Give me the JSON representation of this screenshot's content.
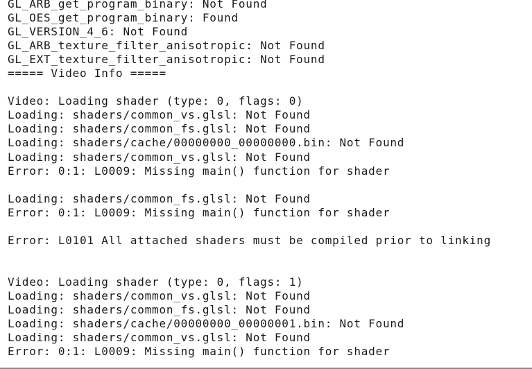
{
  "console": {
    "lines": [
      "GL_ARB_get_program_binary: Not Found",
      "GL_OES_get_program_binary: Found",
      "GL_VERSION_4_6: Not Found",
      "GL_ARB_texture_filter_anisotropic: Not Found",
      "GL_EXT_texture_filter_anisotropic: Not Found",
      "===== Video Info =====",
      "",
      "Video: Loading shader (type: 0, flags: 0)",
      "Loading: shaders/common_vs.glsl: Not Found",
      "Loading: shaders/common_fs.glsl: Not Found",
      "Loading: shaders/cache/00000000_00000000.bin: Not Found",
      "Loading: shaders/common_vs.glsl: Not Found",
      "Error: 0:1: L0009: Missing main() function for shader",
      "",
      "Loading: shaders/common_fs.glsl: Not Found",
      "Error: 0:1: L0009: Missing main() function for shader",
      "",
      "Error: L0101 All attached shaders must be compiled prior to linking",
      "",
      "",
      "Video: Loading shader (type: 0, flags: 1)",
      "Loading: shaders/common_vs.glsl: Not Found",
      "Loading: shaders/common_fs.glsl: Not Found",
      "Loading: shaders/cache/00000000_00000001.bin: Not Found",
      "Loading: shaders/common_vs.glsl: Not Found",
      "Error: 0:1: L0009: Missing main() function for shader"
    ]
  }
}
